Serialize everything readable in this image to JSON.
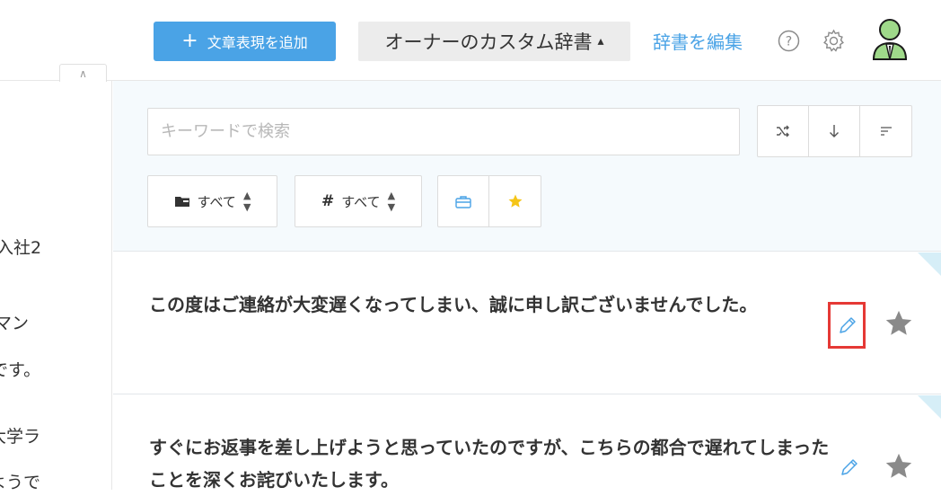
{
  "header": {
    "add_button_label": "文章表現を追加",
    "dictionary_selector": "オーナーのカスタム辞書",
    "edit_dictionary_label": "辞書を編集"
  },
  "left_panel": {
    "text_lines": [
      "入社2",
      "マン",
      "です。",
      "大学ラ",
      "ようで"
    ]
  },
  "filters": {
    "search_placeholder": "キーワードで検索",
    "folder_filter_label": "すべて",
    "tag_filter_label": "すべて",
    "colors": {
      "accent": "#4aa3e6",
      "star_active": "#f5c518",
      "star_inactive": "#8a8a8a"
    }
  },
  "items": [
    {
      "text": "この度はご連絡が大変遅くなってしまい、誠に申し訳ございませんでした。"
    },
    {
      "text": "すぐにお返事を差し上げようと思っていたのですが、こちらの都合で遅れてしまったことを深くお詫びいたします。"
    }
  ]
}
